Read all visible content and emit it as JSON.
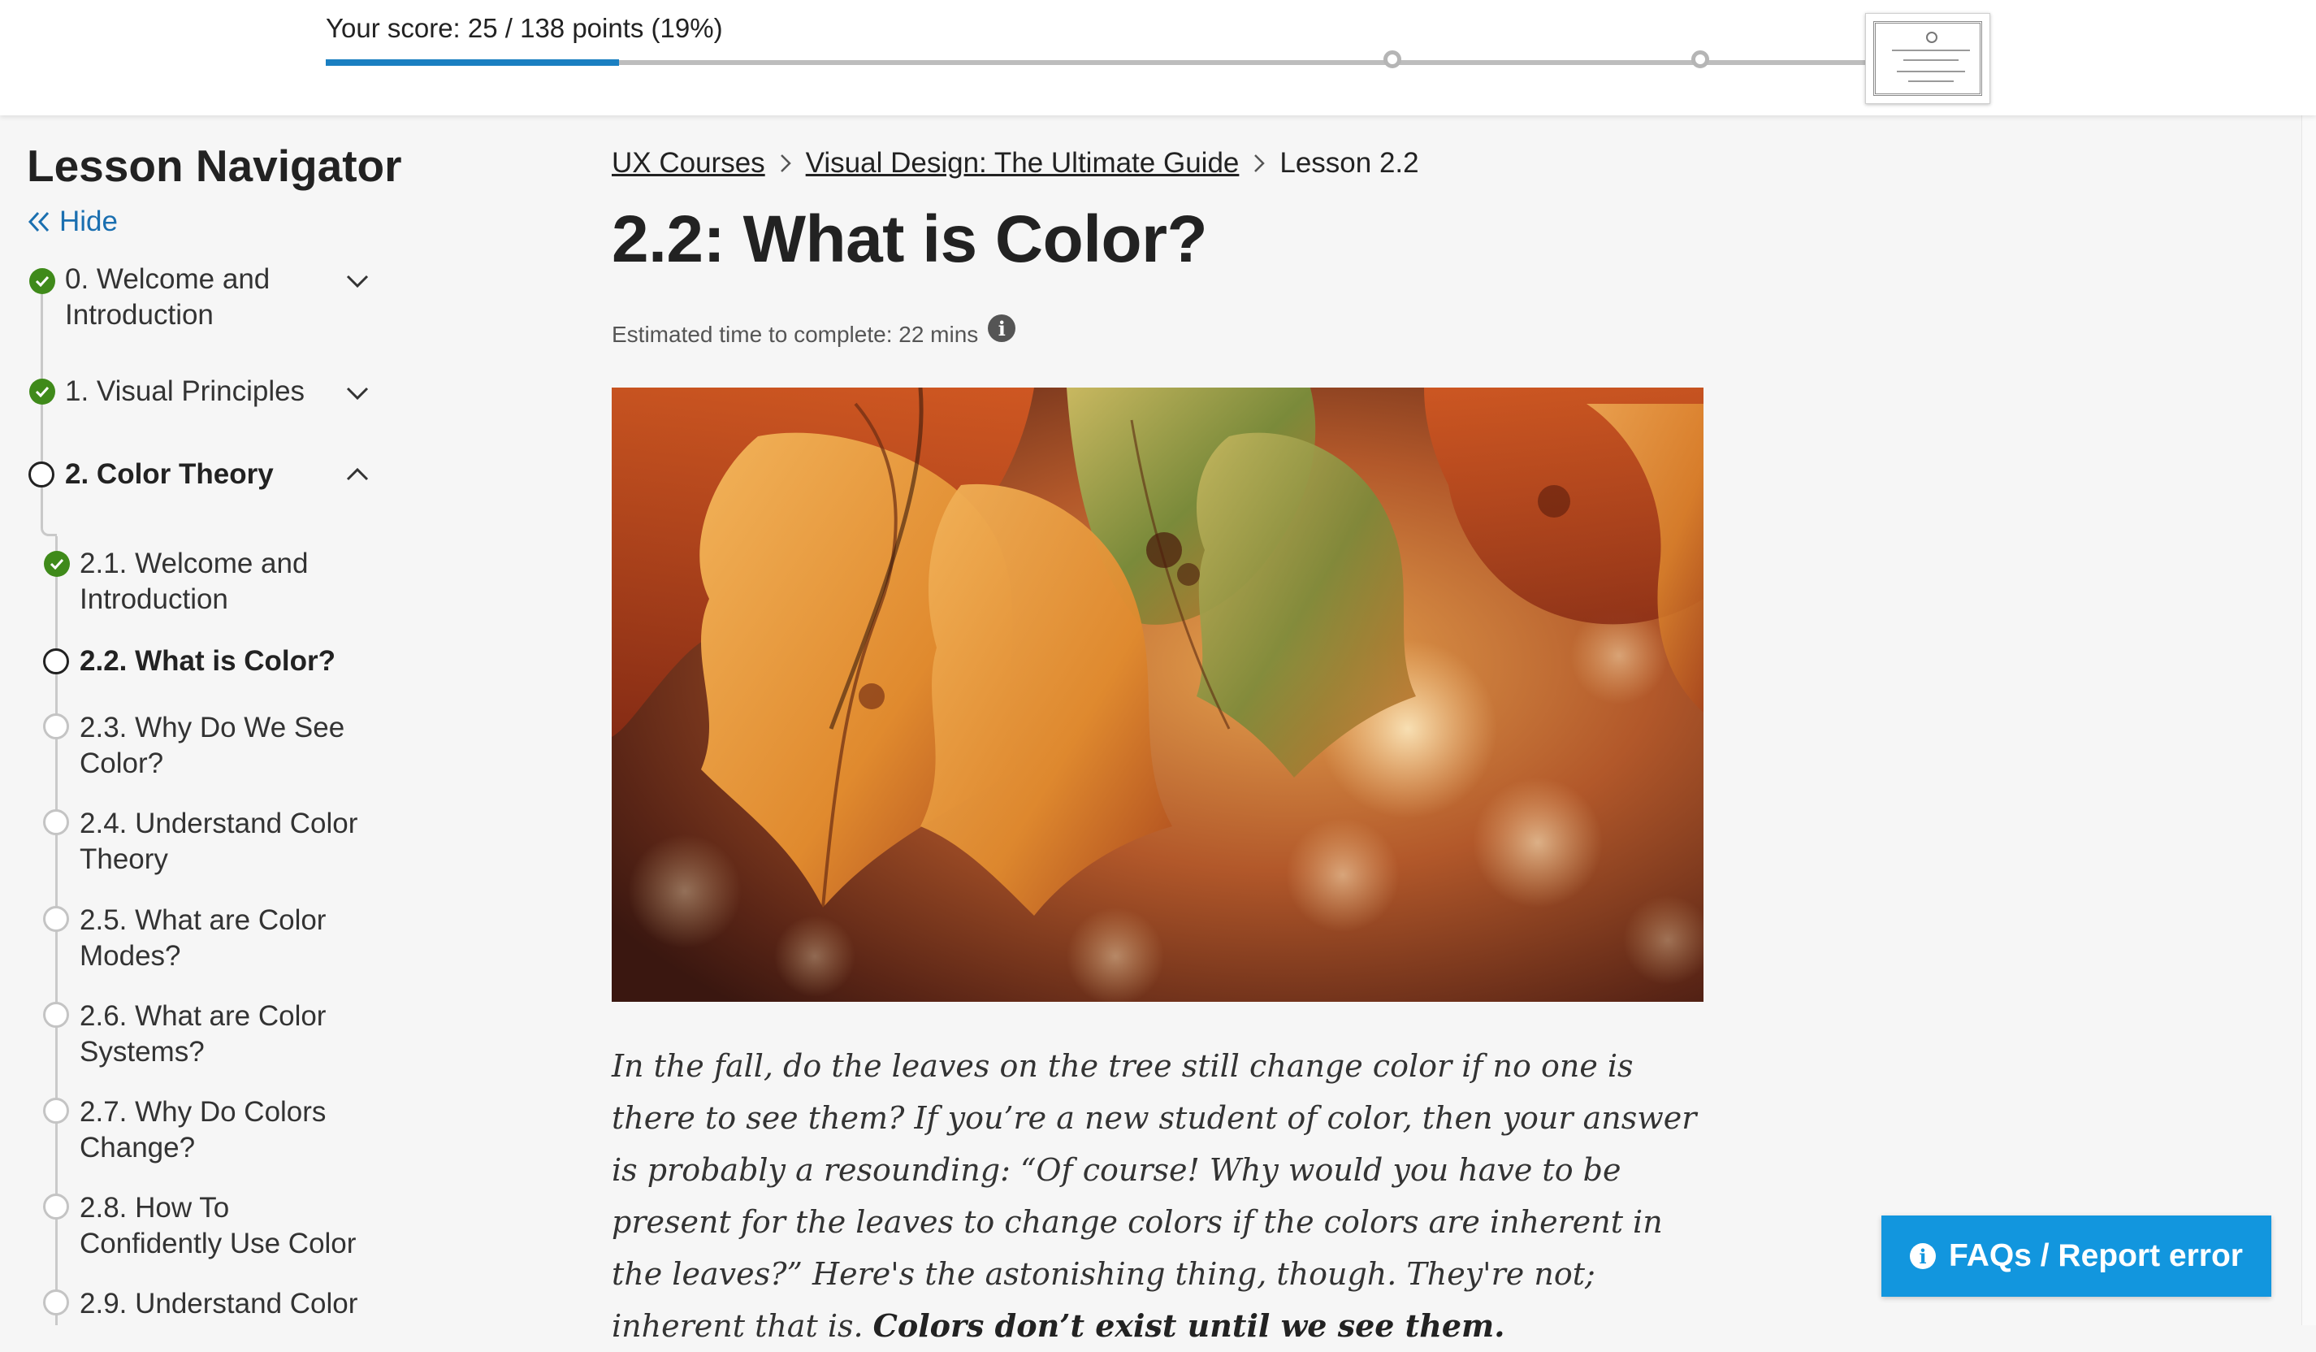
{
  "score": {
    "label": "Your score: 25 / 138 points (19%)",
    "points": 25,
    "total": 138,
    "progress_fraction": 0.19
  },
  "colors": {
    "accent": "#1a7fc1",
    "done_green": "#3f8a1a",
    "faq_button": "#1296de",
    "link_blue": "#1a6fb0"
  },
  "sidebar": {
    "title": "Lesson Navigator",
    "hide_label": "Hide",
    "hide_icon": "double-chevron-left-icon",
    "modules": [
      {
        "label": "0. Welcome and Introduction",
        "status": "done",
        "expanded": false
      },
      {
        "label": "1. Visual Principles",
        "status": "done",
        "expanded": false
      },
      {
        "label": "2. Color Theory",
        "status": "current",
        "expanded": true
      }
    ],
    "lessons": [
      {
        "label": "2.1. Welcome and Introduction",
        "status": "done"
      },
      {
        "label": "2.2. What is Color?",
        "status": "current"
      },
      {
        "label": "2.3. Why Do We See Color?",
        "status": "todo"
      },
      {
        "label": "2.4. Understand Color Theory",
        "status": "todo"
      },
      {
        "label": "2.5. What are Color Modes?",
        "status": "todo"
      },
      {
        "label": "2.6. What are Color Systems?",
        "status": "todo"
      },
      {
        "label": "2.7. Why Do Colors Change?",
        "status": "todo"
      },
      {
        "label": "2.8. How To Confidently Use Color",
        "status": "todo"
      },
      {
        "label": "2.9. Understand Color",
        "status": "todo"
      }
    ]
  },
  "breadcrumb": {
    "items": [
      "UX Courses",
      "Visual Design: The Ultimate Guide",
      "Lesson 2.2"
    ],
    "separator_icon": "chevron-right-icon"
  },
  "lesson": {
    "title": "2.2: What is Color?",
    "estimated_time": "Estimated time to complete: 22 mins",
    "paragraph_plain": "In the fall, do the leaves on the tree still change color if no one is there to see them? If you’re a new student of color, then your answer is probably a resounding: “Of course! Why would you have to be present for the leaves to change colors if the colors are inherent in the leaves?” Here's the astonishing thing, though. They're not; inherent that is.",
    "paragraph_bold": "Colors don’t exist until we see them."
  },
  "faq_button": {
    "label": "FAQs / Report error",
    "icon": "info-icon"
  }
}
